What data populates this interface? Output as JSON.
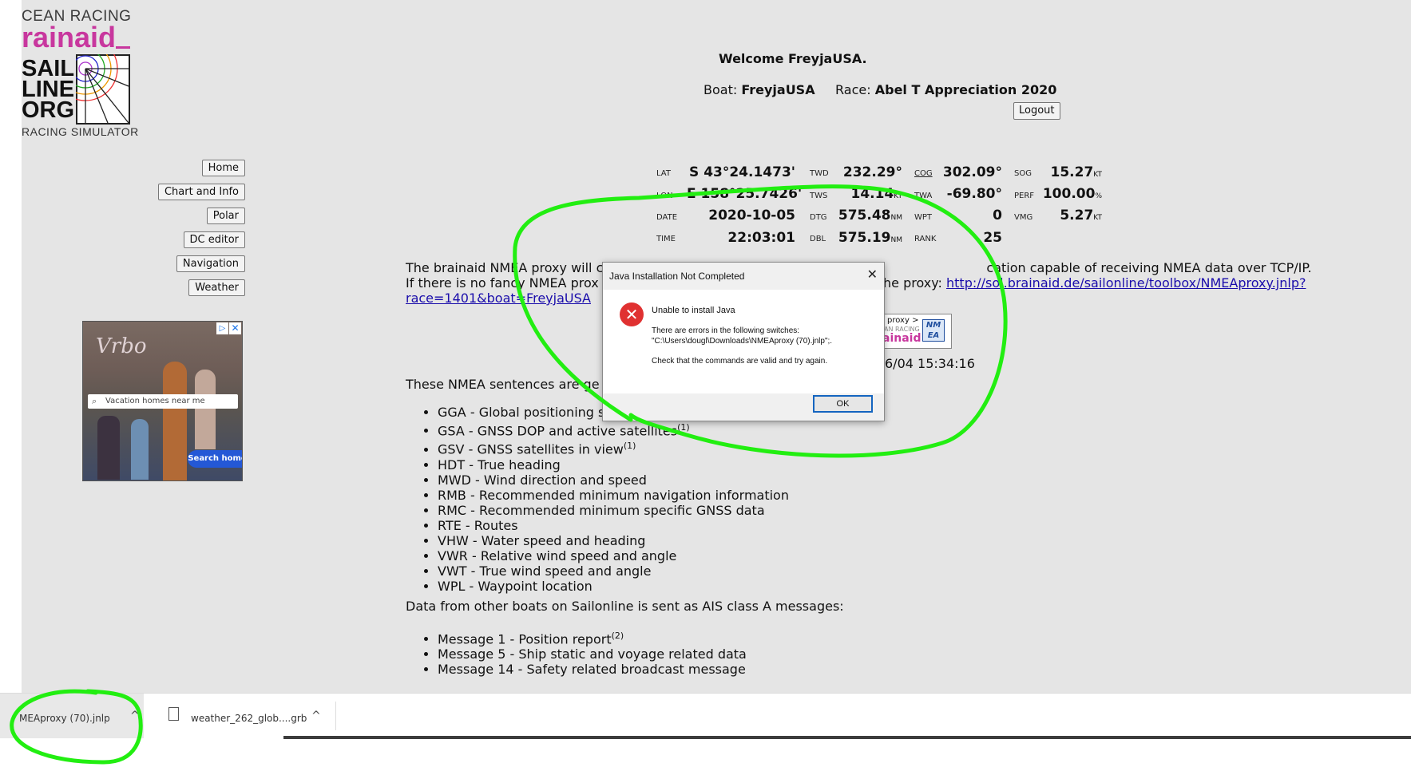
{
  "logo": {
    "line1": "CEAN RACING",
    "line2": "rainaid",
    "line3": "SAIL",
    "line4": "LINE",
    "line5": "ORG",
    "line6": "RACING SIMULATOR"
  },
  "nav": [
    "Home",
    "Chart and Info",
    "Polar",
    "DC editor",
    "Navigation",
    "Weather"
  ],
  "ad": {
    "brand": "Vrbo",
    "search_text": "Vacation homes near me",
    "button": "Search homes"
  },
  "header": {
    "welcome": "Welcome FreyjaUSA.",
    "boat_label": "Boat:",
    "boat": "FreyjaUSA",
    "race_label": "Race:",
    "race": "Abel T Appreciation 2020",
    "logout": "Logout"
  },
  "stats": {
    "lat_label": "LAT",
    "lat": "S 43°24.1473'",
    "lon_label": "LON",
    "lon": "E 158°25.7426'",
    "date_label": "DATE",
    "date": "2020-10-05",
    "time_label": "TIME",
    "time": "22:03:01",
    "twd_label": "TWD",
    "twd": "232.29°",
    "tws_label": "TWS",
    "tws": "14.14",
    "tws_unit": "KT",
    "dtg_label": "DTG",
    "dtg": "575.48",
    "dtg_unit": "NM",
    "dbl_label": "DBL",
    "dbl": "575.19",
    "dbl_unit": "NM",
    "cog_label": "COG",
    "cog": "302.09°",
    "twa_label": "TWA",
    "twa": "-69.80°",
    "wpt_label": "WPT",
    "wpt": "0",
    "rank_label": "RANK",
    "rank": "25",
    "sog_label": "SOG",
    "sog": "15.27",
    "sog_unit": "KT",
    "perf_label": "PERF",
    "perf": "100.00",
    "perf_unit": "%",
    "vmg_label": "VMG",
    "vmg": "5.27",
    "vmg_unit": "KT"
  },
  "body": {
    "p1_line1a": "The brainaid NMEA proxy will c",
    "p1_line1b": "cation capable of receiving NMEA data over TCP/IP.",
    "p1_line2a": "If there is no fancy NMEA prox",
    "p1_line2b": "the proxy: ",
    "link_part1": "http://sol.brainaid.de/sailonline/toolbox/NMEAproxy.jnlp?",
    "link_part2": "race=1401&boat=FreyjaUSA",
    "date_fragment": "6/04 15:34:16",
    "sentences_intro": "These NMEA sentences are ge",
    "sentences": [
      "GGA - Global positioning s",
      "GSA - GNSS DOP and active satellites",
      "GSV - GNSS satellites in view",
      "HDT - True heading",
      "MWD - Wind direction and speed",
      "RMB - Recommended minimum navigation information",
      "RMC - Recommended minimum specific GNSS data",
      "RTE - Routes",
      "VHW - Water speed and heading",
      "VWR - Relative wind speed and angle",
      "VWT - True wind speed and angle",
      "WPL - Waypoint location"
    ],
    "sup1": "(1)",
    "sup2": "(2)",
    "ais_intro": "Data from other boats on Sailonline is sent as AIS class A messages:",
    "ais": [
      "Message 1 - Position report",
      "Message 5 - Ship static and voyage related data",
      "Message 14 - Safety related broadcast message"
    ]
  },
  "badge": {
    "t1": "proxy >",
    "t2": "AN RACING",
    "t3": "ainaid",
    "t4": "NM EA"
  },
  "dialog": {
    "title": "Java Installation Not Completed",
    "heading": "Unable to install Java",
    "line1": "There are errors in the following switches:",
    "line2": "\"C:\\Users\\dougl\\Downloads\\NMEAproxy (70).jnlp\";.",
    "line3": "Check that the commands are valid and try again.",
    "ok": "OK",
    "close": "✕",
    "error_glyph": "✕"
  },
  "downloads": {
    "item1": "MEAproxy (70).jnlp",
    "item2": "weather_262_glob....grb",
    "chevron": "^"
  },
  "colors": {
    "page_bg": "#e5e5e5",
    "brand_magenta": "#c8379e",
    "annotation_green": "#22ee11",
    "link": "#1a0dab"
  }
}
